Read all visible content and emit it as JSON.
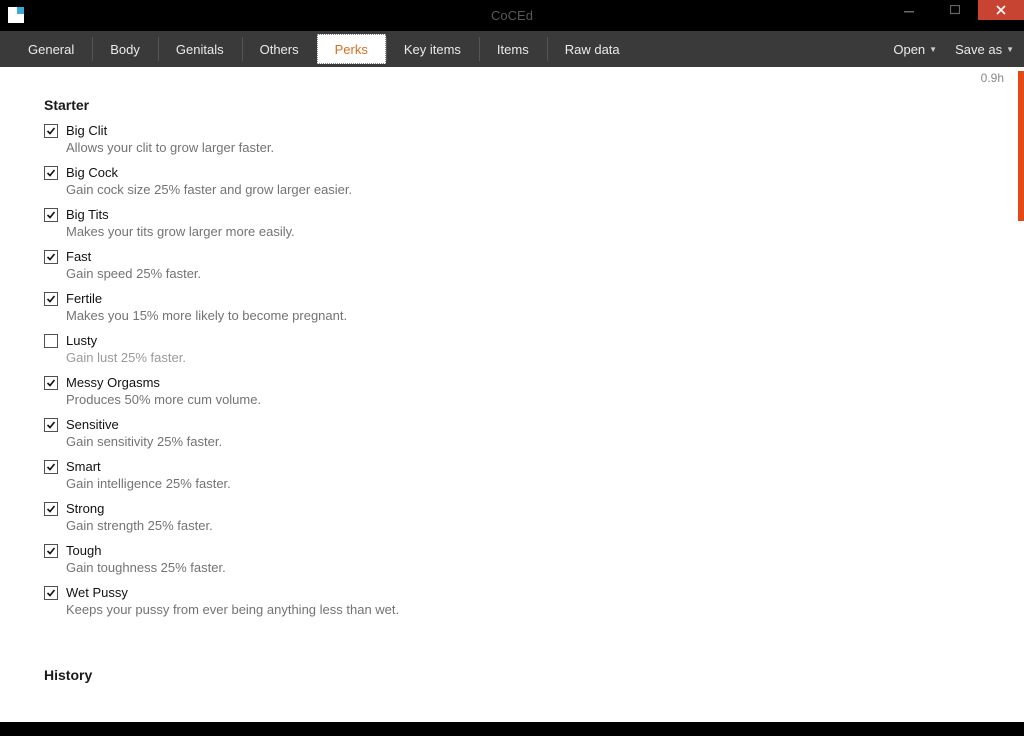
{
  "window": {
    "title": "CoCEd"
  },
  "toolbar": {
    "tabs": [
      {
        "label": "General"
      },
      {
        "label": "Body"
      },
      {
        "label": "Genitals"
      },
      {
        "label": "Others"
      },
      {
        "label": "Perks",
        "active": true
      },
      {
        "label": "Key items"
      },
      {
        "label": "Items"
      },
      {
        "label": "Raw data"
      }
    ],
    "actions": {
      "open": "Open",
      "save_as": "Save as"
    }
  },
  "version": "0.9h",
  "sections": [
    {
      "title": "Starter",
      "items": [
        {
          "name": "Big Clit",
          "checked": true,
          "desc": "Allows your clit to grow larger faster."
        },
        {
          "name": "Big Cock",
          "checked": true,
          "desc": "Gain cock size 25% faster and grow larger easier."
        },
        {
          "name": "Big Tits",
          "checked": true,
          "desc": "Makes your tits grow larger more easily."
        },
        {
          "name": "Fast",
          "checked": true,
          "desc": "Gain speed 25% faster."
        },
        {
          "name": "Fertile",
          "checked": true,
          "desc": "Makes you 15% more likely to become pregnant."
        },
        {
          "name": "Lusty",
          "checked": false,
          "desc": "Gain lust 25% faster."
        },
        {
          "name": "Messy Orgasms",
          "checked": true,
          "desc": "Produces 50% more cum volume."
        },
        {
          "name": "Sensitive",
          "checked": true,
          "desc": "Gain sensitivity 25% faster."
        },
        {
          "name": "Smart",
          "checked": true,
          "desc": "Gain intelligence 25% faster."
        },
        {
          "name": "Strong",
          "checked": true,
          "desc": "Gain strength 25% faster."
        },
        {
          "name": "Tough",
          "checked": true,
          "desc": "Gain toughness 25% faster."
        },
        {
          "name": "Wet Pussy",
          "checked": true,
          "desc": "Keeps your pussy from ever being anything less than wet."
        }
      ]
    },
    {
      "title": "History",
      "items": []
    }
  ]
}
